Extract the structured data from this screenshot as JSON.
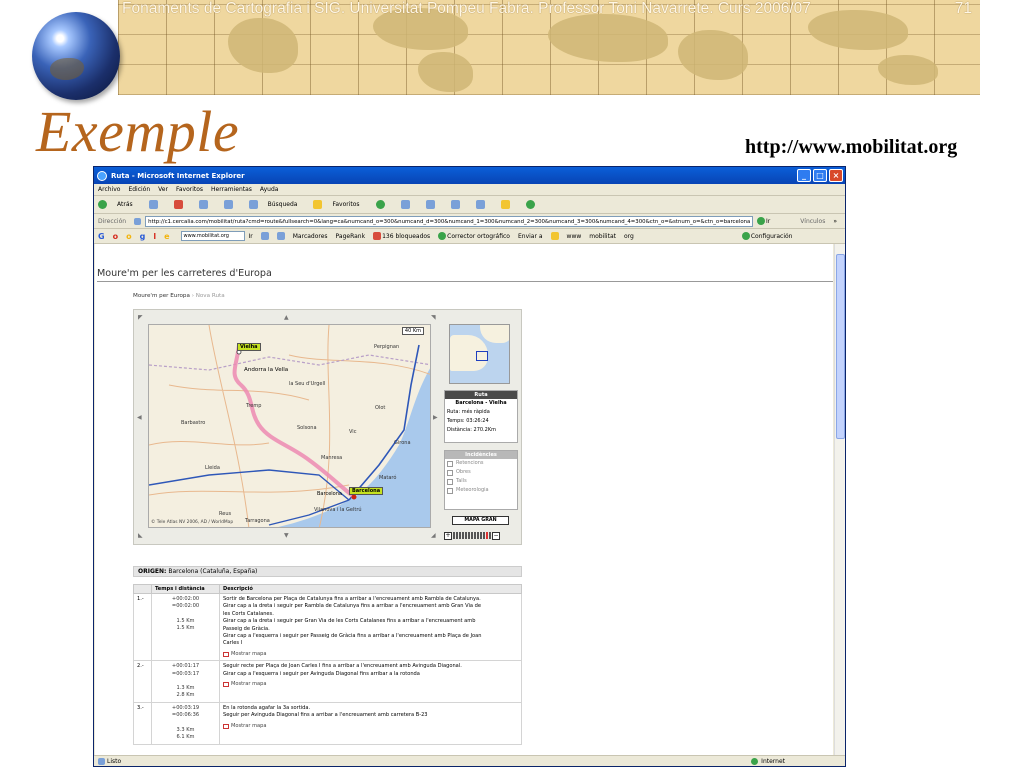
{
  "slide": {
    "header": "Fonaments de Cartografia i SIG. Universitat Pompeu Fabra. Professor Toni Navarrete. Curs 2006/07",
    "page_number": "71",
    "title": "Exemple",
    "url": "http://www.mobilitat.org"
  },
  "window": {
    "title": "Ruta - Microsoft Internet Explorer",
    "buttons": [
      "_",
      "□",
      "×"
    ]
  },
  "menu": [
    "Archivo",
    "Edición",
    "Ver",
    "Favoritos",
    "Herramientas",
    "Ayuda"
  ],
  "toolbar": {
    "back": "Atrás",
    "search": "Búsqueda",
    "favorites": "Favoritos"
  },
  "address": {
    "label": "Dirección",
    "value": "http://c1.cercalia.com/mobilitat/ruta?cmd=route&fullsearch=0&lang=ca&numcand_o=300&numcand_d=300&numcand_1=300&numcand_2=300&numcand_3=300&numcand_4=300&ctn_o=&stnum_o=&ctn_o=barcelona",
    "go": "Ir",
    "links": "Vínculos"
  },
  "google": {
    "logo": "Google",
    "search_value": "www.mobilitat.org",
    "go": "Ir",
    "bookmarks": "Marcadores",
    "pagerank": "PageRank",
    "blocked": "136 bloqueados",
    "spellcheck": "Corrector ortográfico",
    "send": "Enviar a",
    "hl1": "www",
    "hl2": "mobilitat",
    "hl3": "org",
    "settings": "Configuración"
  },
  "page": {
    "site_title": "Moure'm per les carreteres d'Europa",
    "breadcrumb_main": "Moure'm per Europa",
    "breadcrumb_sub": "› Nova Ruta"
  },
  "map": {
    "labels": {
      "vielha": "Vielha",
      "barcelona_pin": "Barcelona",
      "andorra": "Andorra la Vella",
      "perpignan": "Perpignan",
      "seu": "la Seu d'Urgell",
      "tremp": "Tremp",
      "olot": "Olot",
      "solsona": "Solsona",
      "barbastro": "Barbastro",
      "vic": "Vic",
      "manresa": "Manresa",
      "girona": "Girona",
      "lleida": "Lleida",
      "mataro": "Mataró",
      "barcelona": "Barcelona",
      "vilanova": "Vilanova i la Geltrú",
      "tarragona": "Tarragona",
      "reus": "Reus"
    },
    "scale": "40 Km",
    "copyright": "© Tele Atlas NV 2006, AD / WorldMap"
  },
  "route_box": {
    "header": "Ruta",
    "name": "Barcelona - Vielha",
    "type": "Ruta: més ràpida",
    "time": "Temps: 03:26:24",
    "distance": "Distància: 270.2Km"
  },
  "incidents": {
    "header": "Incidències",
    "items": [
      "Retencions",
      "Obres",
      "Talls",
      "Meteorologia"
    ]
  },
  "big_map_button": "MAPA GRAN",
  "zoom": {
    "levels": 13,
    "current_level": 11
  },
  "origin": {
    "label": "ORIGEN:",
    "value": "Barcelona (Cataluña, España)"
  },
  "table": {
    "headers": [
      "",
      "Temps i distància",
      "Descripció"
    ],
    "show_map": "Mostrar mapa",
    "rows": [
      {
        "num": "1.-",
        "t1": "+00:02:00",
        "t2": "=00:02:00",
        "d1": "1.5 Km",
        "d2": "1.5 Km",
        "lines": [
          "Sortir de Barcelona per Plaça de Catalunya fins a arribar a l'encreuament amb Rambla de Catalunya.",
          "Girar cap a la dreta i seguir per Rambla de Catalunya fins a arribar a l'encreuament amb Gran Via de",
          "les Corts Catalanes.",
          "Girar cap a la dreta i seguir per Gran Via de les Corts Catalanes fins a arribar a l'encreuament amb",
          "Passeig de Gràcia.",
          "Girar cap a l'esquerra i seguir per Passeig de Gràcia fins a arribar a l'encreuament amb Plaça de Joan",
          "Carles I"
        ]
      },
      {
        "num": "2.-",
        "t1": "+00:01:17",
        "t2": "=00:03:17",
        "d1": "1.3 Km",
        "d2": "2.8 Km",
        "lines": [
          "Seguir recte per Plaça de Joan Carles I fins a arribar a l'encreuament amb Avinguda Diagonal.",
          "Girar cap a l'esquerra i seguir per Avinguda Diagonal fins arribar a la rotonda"
        ]
      },
      {
        "num": "3.-",
        "t1": "+00:03:19",
        "t2": "=00:06:36",
        "d1": "3.3 Km",
        "d2": "6.1 Km",
        "lines": [
          "En la rotonda agafar la 3a sortida.",
          "Seguir per Avinguda Diagonal fins a arribar a l'encreuament amb carretera B-23"
        ]
      }
    ]
  },
  "status": {
    "left": "Listo",
    "zone": "Internet"
  }
}
